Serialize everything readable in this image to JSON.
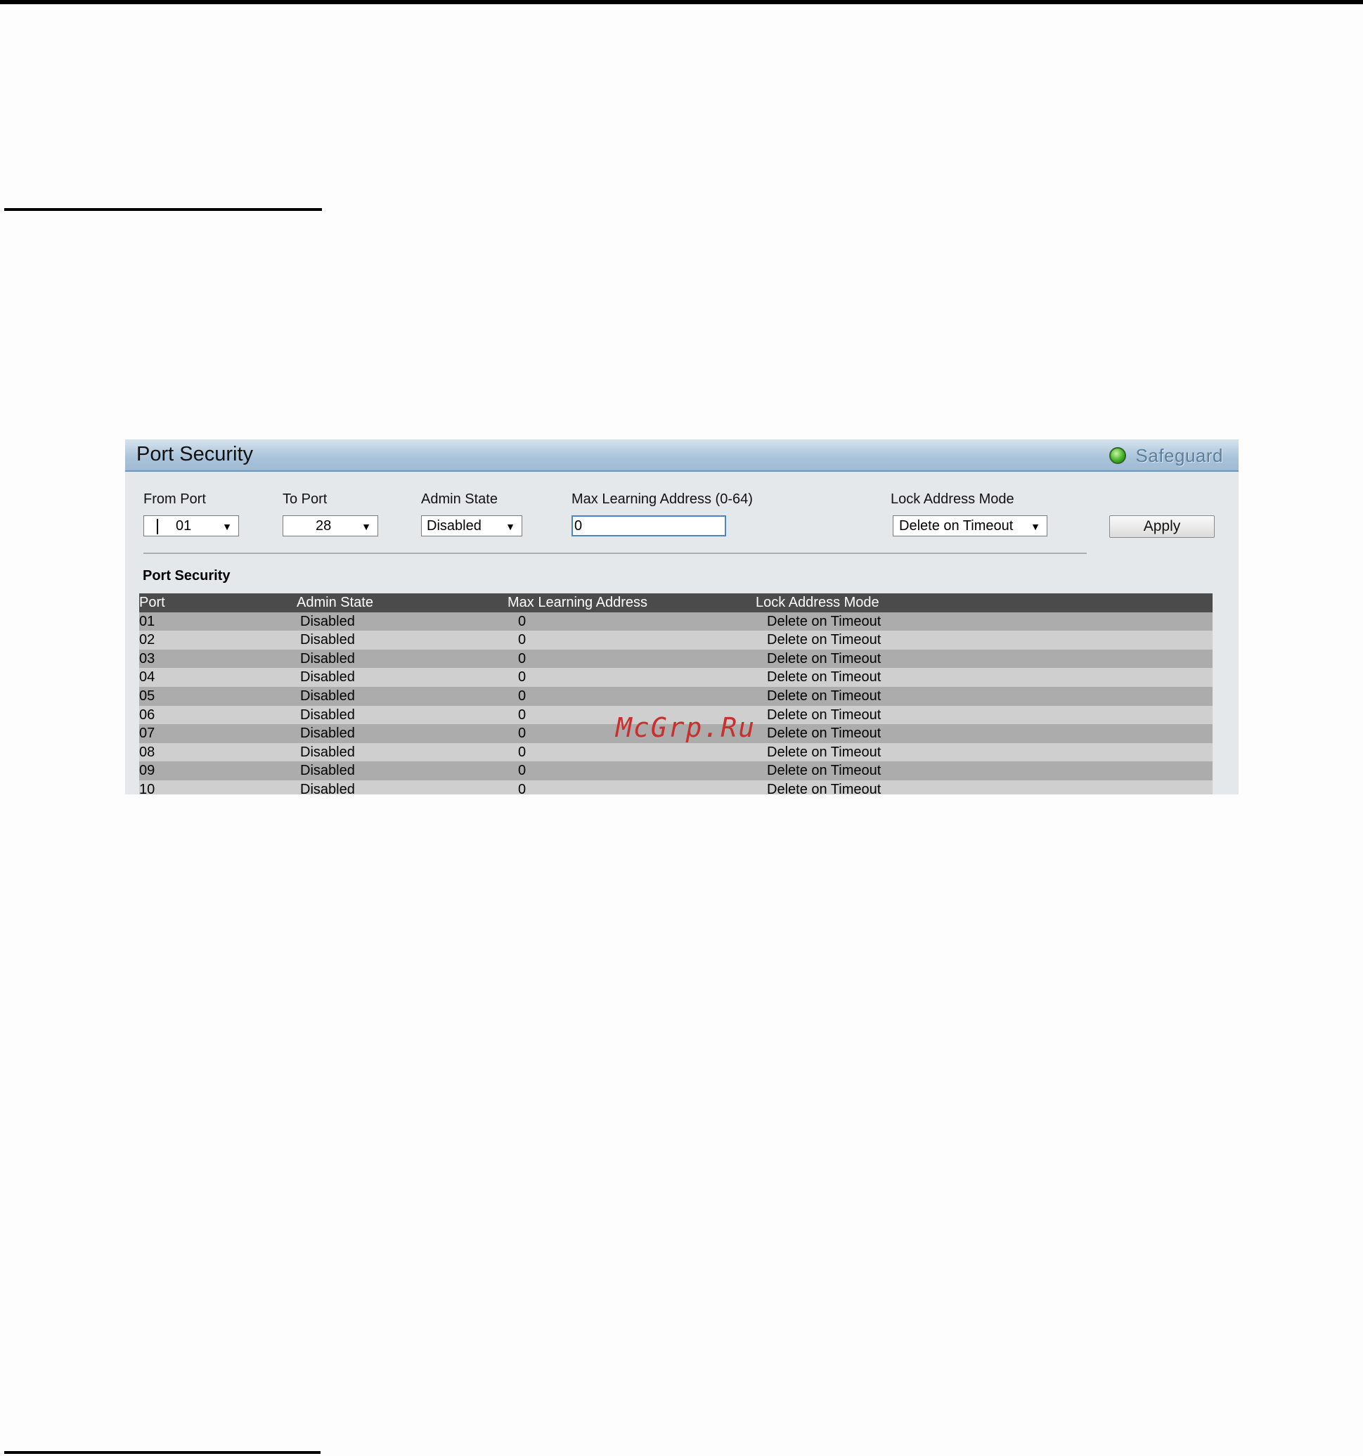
{
  "panel": {
    "title": "Port Security",
    "safeguard_label": "Safeguard",
    "safeguard_status_color": "#46b32a",
    "header_color": "#a9c3da"
  },
  "form": {
    "from_port": {
      "label": "From Port",
      "value": "01"
    },
    "to_port": {
      "label": "To Port",
      "value": "28"
    },
    "admin_state": {
      "label": "Admin State",
      "value": "Disabled"
    },
    "max_learning": {
      "label": "Max Learning Address (0-64)",
      "value": "0"
    },
    "lock_mode": {
      "label": "Lock Address Mode",
      "value": "Delete on Timeout"
    },
    "apply_label": "Apply"
  },
  "table": {
    "title": "Port Security",
    "columns": [
      "Port",
      "Admin State",
      "Max Learning Address",
      "Lock Address Mode"
    ],
    "rows": [
      [
        "01",
        "Disabled",
        "0",
        "Delete on Timeout"
      ],
      [
        "02",
        "Disabled",
        "0",
        "Delete on Timeout"
      ],
      [
        "03",
        "Disabled",
        "0",
        "Delete on Timeout"
      ],
      [
        "04",
        "Disabled",
        "0",
        "Delete on Timeout"
      ],
      [
        "05",
        "Disabled",
        "0",
        "Delete on Timeout"
      ],
      [
        "06",
        "Disabled",
        "0",
        "Delete on Timeout"
      ],
      [
        "07",
        "Disabled",
        "0",
        "Delete on Timeout"
      ],
      [
        "08",
        "Disabled",
        "0",
        "Delete on Timeout"
      ],
      [
        "09",
        "Disabled",
        "0",
        "Delete on Timeout"
      ],
      [
        "10",
        "Disabled",
        "0",
        "Delete on Timeout"
      ]
    ]
  },
  "watermark": "McGrp.Ru"
}
